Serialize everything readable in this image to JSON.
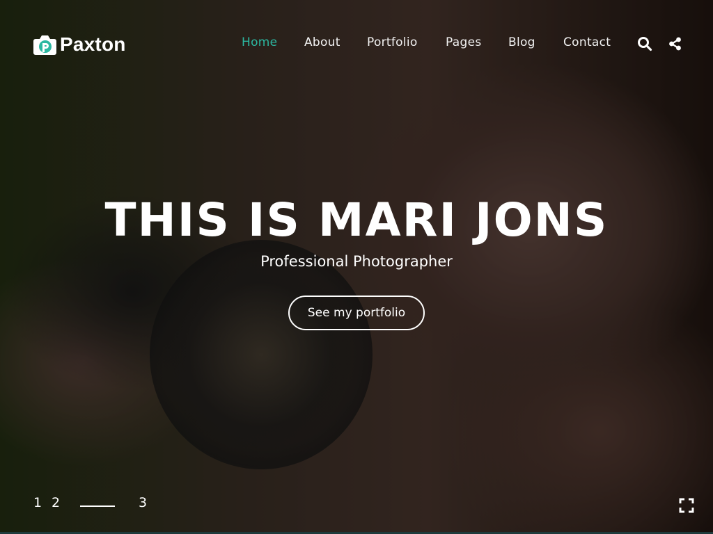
{
  "brand": {
    "name": "Paxton",
    "logo_icon": "camera-p-logo",
    "accent_color": "#2cb8a1"
  },
  "nav": {
    "items": [
      {
        "label": "Home",
        "active": true
      },
      {
        "label": "About",
        "active": false
      },
      {
        "label": "Portfolio",
        "active": false
      },
      {
        "label": "Pages",
        "active": false
      },
      {
        "label": "Blog",
        "active": false
      },
      {
        "label": "Contact",
        "active": false
      }
    ],
    "search_icon": "search-icon",
    "share_icon": "share-icon"
  },
  "hero": {
    "title": "THIS IS MARI JONS",
    "subtitle": "Professional Photographer",
    "cta_label": "See my portfolio"
  },
  "slider": {
    "pages": [
      "1",
      "2",
      "3"
    ],
    "active_page": "2",
    "fullscreen_icon": "fullscreen-icon"
  }
}
